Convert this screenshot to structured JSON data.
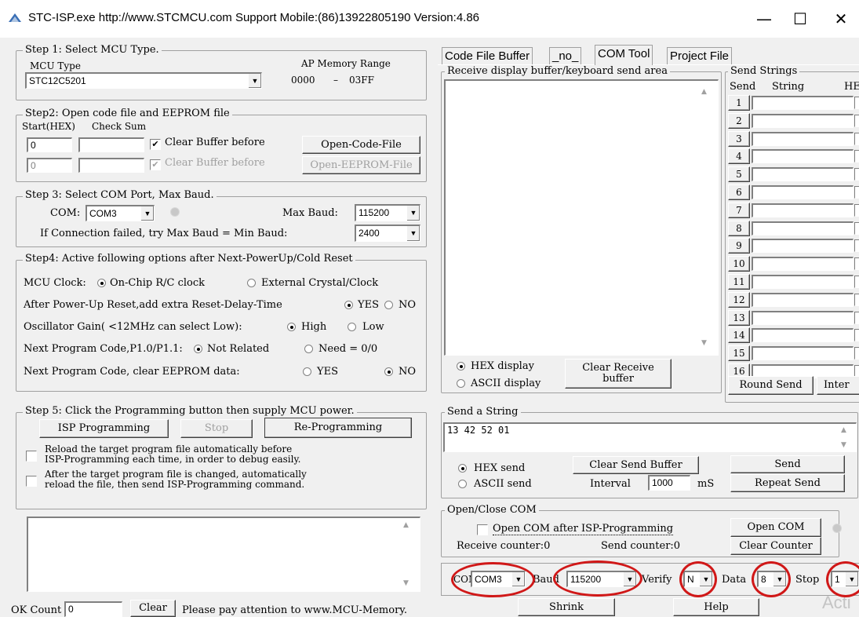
{
  "window": {
    "title": "STC-ISP.exe http://www.STCMCU.com Support Mobile:(86)13922805190 Version:4.86",
    "minimize": "—",
    "maximize": "☐",
    "close": "✕"
  },
  "step1": {
    "title": "Step 1: Select MCU Type.",
    "mcu_type_label": "MCU Type",
    "mcu_type_value": "STC12C5201",
    "ap_range_label": "AP Memory Range",
    "ap_start": "0000",
    "ap_dash": "–",
    "ap_end": "03FF"
  },
  "step2": {
    "title": "Step2: Open code file and EEPROM file",
    "start_label": "Start(HEX)",
    "checksum_label": "Check Sum",
    "code_start": "0",
    "code_checksum": "",
    "eeprom_start": "0",
    "eeprom_checksum": "",
    "clear_buffer_1": "Clear Buffer before",
    "clear_buffer_2": "Clear Buffer before",
    "open_code": "Open-Code-File",
    "open_eeprom": "Open-EEPROM-File"
  },
  "step3": {
    "title": "Step 3: Select COM Port, Max Baud.",
    "com_label": "COM:",
    "com_value": "COM3",
    "max_baud_label": "Max Baud:",
    "max_baud_value": "115200",
    "min_baud_label": "If Connection failed, try Max Baud = Min Baud:",
    "min_baud_value": "2400"
  },
  "step4": {
    "title": "Step4: Active following options after Next-PowerUp/Cold Reset",
    "row1_label": "MCU Clock:",
    "row1_opt1": "On-Chip R/C clock",
    "row1_opt2": "External Crystal/Clock",
    "row2_label": "After Power-Up Reset,add extra Reset-Delay-Time",
    "row2_opt1": "YES",
    "row2_opt2": "NO",
    "row3_label": "Oscillator Gain( <12MHz can select Low):",
    "row3_opt1": "High",
    "row3_opt2": "Low",
    "row4_label": "Next Program Code,P1.0/P1.1:",
    "row4_opt1": "Not Related",
    "row4_opt2": "Need = 0/0",
    "row5_label": "Next Program Code, clear EEPROM data:",
    "row5_opt1": "YES",
    "row5_opt2": "NO"
  },
  "step5": {
    "title": "Step 5: Click the Programming button then supply MCU power.",
    "isp_btn": "ISP Programming",
    "stop_btn": "Stop",
    "reprog_btn": "Re-Programming",
    "reload1_l1": "Reload the target program file automatically before",
    "reload1_l2": "ISP-Programming each time, in order to debug easily.",
    "reload2_l1": "After the target program file is changed, automatically",
    "reload2_l2": "reload the file, then send ISP-Programming command."
  },
  "status": {
    "ok_count_label": "OK Count",
    "ok_count_value": "0",
    "clear_btn": "Clear",
    "notice": "Please pay attention to www.MCU-Memory."
  },
  "tabs": [
    "Code File Buffer",
    "_no_",
    "COM Tool",
    "Project File"
  ],
  "receive": {
    "title": "Receive display buffer/keyboard send area",
    "hex_display": "HEX display",
    "ascii_display": "ASCII display",
    "clear_btn_l1": "Clear Receive",
    "clear_btn_l2": "buffer"
  },
  "send_strings": {
    "title": "Send Strings",
    "col_send": "Send",
    "col_string": "String",
    "col_hex": "HE",
    "rows": [
      "1",
      "2",
      "3",
      "4",
      "5",
      "6",
      "7",
      "8",
      "9",
      "10",
      "11",
      "12",
      "13",
      "14",
      "15",
      "16"
    ],
    "round_send": "Round Send",
    "interval": "Inter"
  },
  "send_string": {
    "title": "Send a String",
    "value": "13 42 52 01",
    "hex_send": "HEX send",
    "ascii_send": "ASCII send",
    "clear_btn": "Clear Send Buffer",
    "interval_label": "Interval",
    "interval_value": "1000",
    "interval_unit": "mS",
    "send_btn": "Send",
    "repeat_btn": "Repeat Send"
  },
  "open_close": {
    "title": "Open/Close COM",
    "after_isp": "Open COM after ISP-Programming",
    "open_btn": "Open COM",
    "recv_counter": "Receive counter:0",
    "send_counter": "Send counter:0",
    "clear_counter": "Clear Counter"
  },
  "bottom": {
    "com_label": "COM",
    "com_value": "COM3",
    "baud_label": "Baud",
    "baud_value": "115200",
    "verify_label": "Verify",
    "verify_value": "N",
    "data_label": "Data",
    "data_value": "8",
    "stop_label": "Stop",
    "stop_value": "1",
    "shrink_btn": "Shrink",
    "help_btn": "Help",
    "watermark": "Acti"
  },
  "colors": {
    "annotation_ring": "#d01818",
    "window_bg": "#f0f0f0"
  }
}
